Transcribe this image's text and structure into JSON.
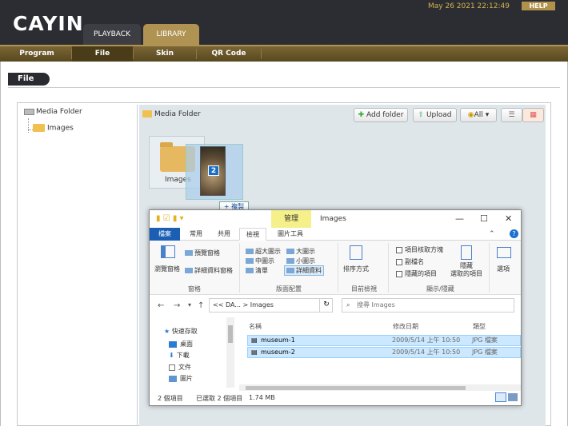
{
  "app": {
    "logo": "CAYIN",
    "datetime": "May 26 2021 22:12:49",
    "help": "HELP"
  },
  "main_tabs": [
    {
      "label": "PLAYBACK"
    },
    {
      "label": "LIBRARY"
    }
  ],
  "sub_nav": [
    {
      "label": "Program"
    },
    {
      "label": "File"
    },
    {
      "label": "Skin"
    },
    {
      "label": "QR Code"
    }
  ],
  "section_title": "File",
  "tree": {
    "root": "Media Folder",
    "child": "Images"
  },
  "main": {
    "header": "Media Folder",
    "add_folder": "Add folder",
    "upload": "Upload",
    "filter": "All",
    "folder_name": "Images"
  },
  "drag": {
    "badge": "2",
    "tip": "+ 複製"
  },
  "explorer": {
    "manage": "管理",
    "title": "Images",
    "tabs": [
      "檔案",
      "常用",
      "共用",
      "檢視",
      "圖片工具"
    ],
    "ribbon": {
      "nav_pane": "瀏覽窗格",
      "preview": "預覽窗格",
      "details_pane": "詳細資料窗格",
      "group_pane": "窗格",
      "layouts": [
        "超大圖示",
        "大圖示",
        "中圖示",
        "小圖示",
        "清單",
        "詳細資料"
      ],
      "group_layout": "版面配置",
      "sort": "排序方式",
      "group_view": "目前檢視",
      "check_boxes": "項目核取方塊",
      "extensions": "副檔名",
      "hidden_items": "隱藏的項目",
      "hide_selected": "隱藏\n選取的項目",
      "group_showhide": "顯示/隱藏",
      "options": "選項"
    },
    "address": "<< DA... > Images",
    "search_placeholder": "搜尋 Images",
    "nav_items": [
      "快速存取",
      "桌面",
      "下載",
      "文件",
      "圖片"
    ],
    "columns": [
      "名稱",
      "修改日期",
      "類型"
    ],
    "files": [
      {
        "name": "museum-1",
        "date": "2009/5/14 上午 10:50",
        "type": "JPG 檔案"
      },
      {
        "name": "museum-2",
        "date": "2009/5/14 上午 10:50",
        "type": "JPG 檔案"
      }
    ],
    "status": {
      "count": "2 個項目",
      "selected": "已選取 2 個項目",
      "size": "1.74 MB"
    }
  }
}
